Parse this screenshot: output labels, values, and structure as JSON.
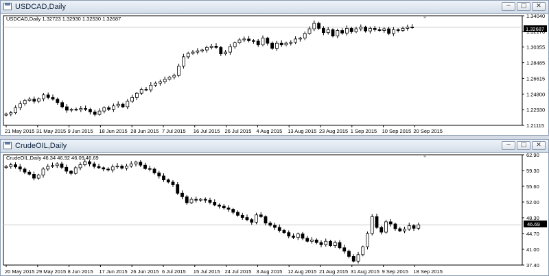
{
  "windows": [
    {
      "id": "usdcad",
      "title": "USDCAD,Daily",
      "header": "USDCAD,Daily  1.32723 1.32930 1.32530 1.32687",
      "current_price": "1.32687",
      "price_ticks": [
        "1.34040",
        "1.32170",
        "1.30355",
        "1.28485",
        "1.26615",
        "1.24800",
        "1.22930",
        "1.21115"
      ],
      "date_ticks": [
        "21 May 2015",
        "31 May 2015",
        "9 Jun 2015",
        "18 Jun 2015",
        "28 Jun 2015",
        "7 Jul 2015",
        "16 Jul 2015",
        "26 Jul 2015",
        "4 Aug 2015",
        "13 Aug 2015",
        "23 Aug 2015",
        "1 Sep 2015",
        "10 Sep 2015",
        "20 Sep 2015"
      ],
      "price_min": 1.21115,
      "price_max": 1.3404,
      "bar_count": 88,
      "closes": [
        1.2245,
        1.226,
        1.232,
        1.2365,
        1.2405,
        1.242,
        1.2395,
        1.2425,
        1.247,
        1.244,
        1.242,
        1.238,
        1.233,
        1.229,
        1.23,
        1.2295,
        1.231,
        1.23,
        1.227,
        1.224,
        1.228,
        1.232,
        1.23,
        1.234,
        1.236,
        1.233,
        1.2395,
        1.244,
        1.249,
        1.2535,
        1.253,
        1.2585,
        1.261,
        1.2625,
        1.2655,
        1.268,
        1.27,
        1.281,
        1.292,
        1.296,
        1.2975,
        1.299,
        1.3,
        1.303,
        1.3045,
        1.303,
        1.2955,
        1.2975,
        1.304,
        1.3085,
        1.312,
        1.313,
        1.311,
        1.3105,
        1.306,
        1.314,
        1.308,
        1.302,
        1.308,
        1.306,
        1.308,
        1.309,
        1.313,
        1.314,
        1.3195,
        1.325,
        1.3315,
        1.3255,
        1.3205,
        1.324,
        1.3165,
        1.323,
        1.32,
        1.3255,
        1.3215,
        1.325,
        1.327,
        1.3225,
        1.3255,
        1.324,
        1.323,
        1.325,
        1.3195,
        1.324,
        1.323,
        1.3255,
        1.327,
        1.32687
      ]
    },
    {
      "id": "crudeoil",
      "title": "CrudeOIL,Daily",
      "header": "CrudeOIL,Daily  46.34 46.92 46.09 46.69",
      "current_price": "46.69",
      "price_ticks": [
        "62.90",
        "59.30",
        "55.60",
        "52.00",
        "48.30",
        "44.70",
        "41.00",
        "37.40"
      ],
      "date_ticks": [
        "20 May 2015",
        "29 May 2015",
        "8 Jun 2015",
        "17 Jun 2015",
        "26 Jun 2015",
        "6 Jul 2015",
        "15 Jul 2015",
        "24 Jul 2015",
        "3 Aug 2015",
        "12 Aug 2015",
        "21 Aug 2015",
        "31 Aug 2015",
        "9 Sep 2015",
        "18 Sep 2015"
      ],
      "price_min": 37.4,
      "price_max": 62.9,
      "bar_count": 90,
      "closes": [
        60.2,
        60.6,
        60.1,
        59.6,
        58.9,
        58.4,
        57.5,
        58.2,
        59.6,
        60.2,
        60.4,
        60.8,
        60.0,
        59.1,
        58.6,
        59.9,
        60.6,
        61.3,
        60.8,
        60.2,
        59.9,
        59.6,
        59.4,
        60.1,
        60.3,
        59.8,
        60.3,
        60.8,
        61.2,
        60.5,
        59.7,
        59.6,
        58.7,
        58.0,
        57.1,
        56.6,
        56.0,
        54.0,
        53.2,
        51.8,
        52.6,
        52.4,
        52.6,
        52.4,
        51.9,
        51.3,
        51.0,
        50.6,
        50.3,
        49.6,
        48.9,
        48.4,
        47.9,
        47.3,
        49.0,
        48.6,
        47.1,
        46.6,
        46.1,
        45.4,
        44.9,
        44.1,
        43.8,
        44.6,
        43.6,
        42.9,
        43.2,
        42.6,
        42.1,
        42.9,
        41.9,
        42.6,
        41.4,
        40.6,
        39.4,
        38.3,
        39.8,
        41.6,
        44.7,
        48.6,
        46.1,
        45.0,
        47.4,
        46.9,
        45.8,
        45.3,
        45.7,
        46.5,
        45.9,
        46.69
      ]
    }
  ],
  "colors": {
    "bull": "#ffffff",
    "bear": "#000000",
    "grid": "#c9c9c9",
    "frame": "#000000"
  },
  "icons": {
    "window_icon": "chart-window-icon",
    "minimize": "minimize-icon",
    "maximize": "maximize-icon",
    "close": "close-icon",
    "shift_marker": "chart-shift-triangle-icon"
  }
}
